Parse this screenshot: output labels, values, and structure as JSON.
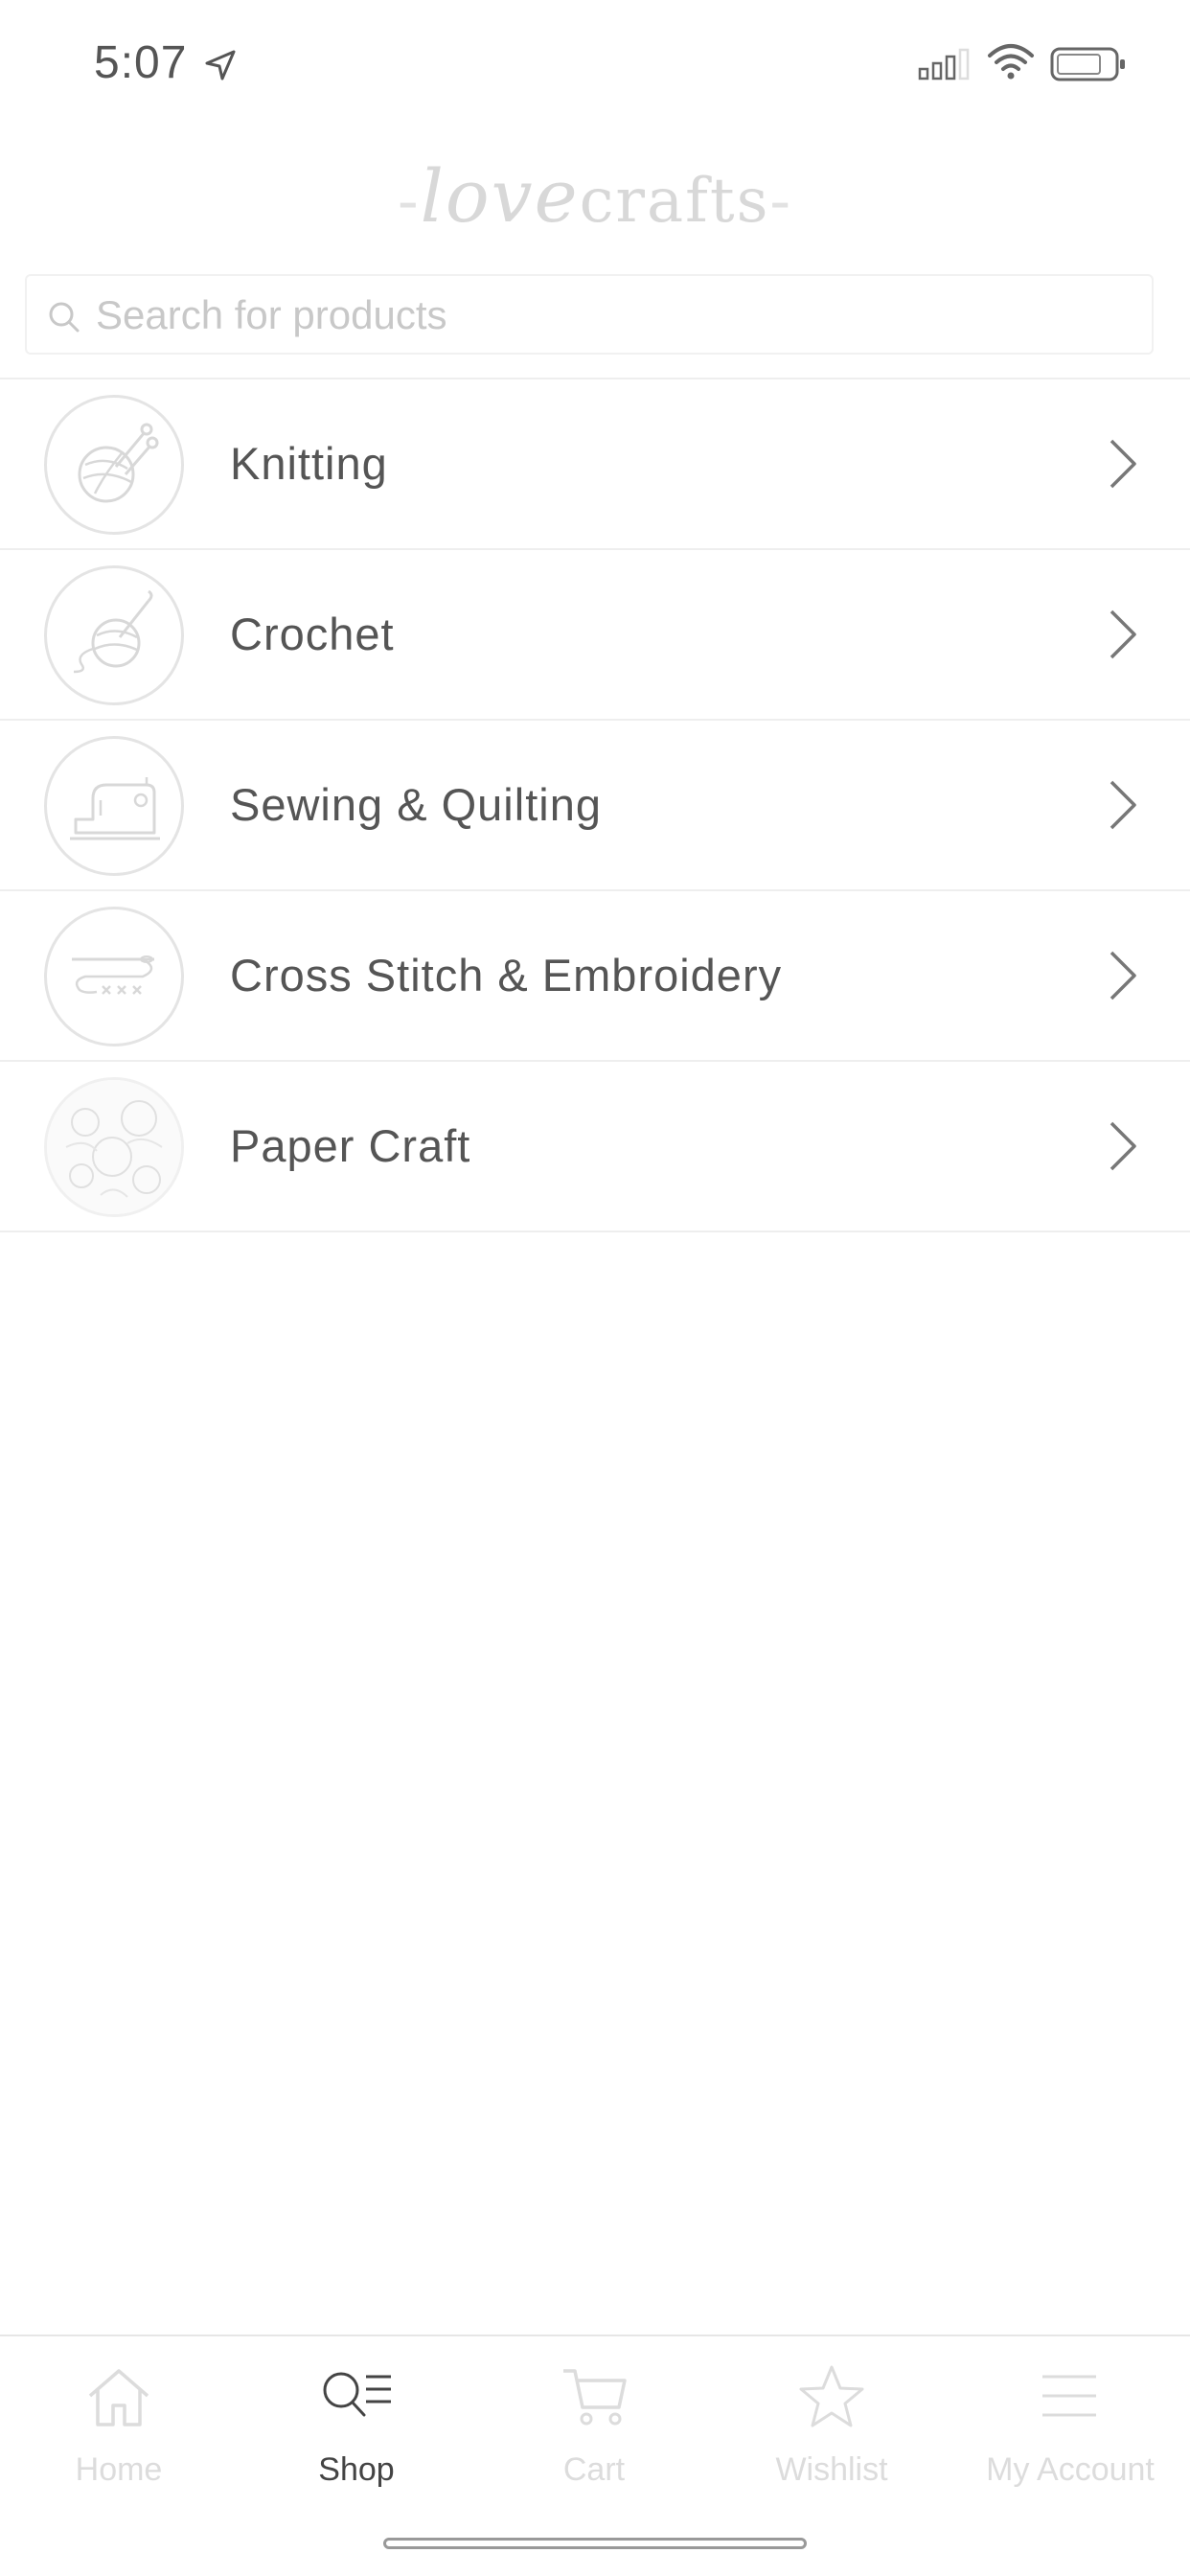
{
  "status_bar": {
    "time": "5:07"
  },
  "logo": {
    "script_part": "love",
    "plain_part": "crafts"
  },
  "search": {
    "placeholder": "Search for products"
  },
  "categories": [
    {
      "label": "Knitting",
      "icon": "yarn-needles-icon"
    },
    {
      "label": "Crochet",
      "icon": "yarn-hook-icon"
    },
    {
      "label": "Sewing & Quilting",
      "icon": "sewing-machine-icon"
    },
    {
      "label": "Cross Stitch & Embroidery",
      "icon": "needle-thread-icon"
    },
    {
      "label": "Paper Craft",
      "icon": "paper-pattern-icon"
    }
  ],
  "tabs": [
    {
      "label": "Home",
      "icon": "home-icon",
      "active": false
    },
    {
      "label": "Shop",
      "icon": "search-menu-icon",
      "active": true
    },
    {
      "label": "Cart",
      "icon": "cart-icon",
      "active": false
    },
    {
      "label": "Wishlist",
      "icon": "star-icon",
      "active": false
    },
    {
      "label": "My Account",
      "icon": "menu-icon",
      "active": false
    }
  ],
  "colors": {
    "text": "#555555",
    "muted": "#c8c8c8",
    "divider": "#eeeeee",
    "active_tab": "#444444"
  }
}
